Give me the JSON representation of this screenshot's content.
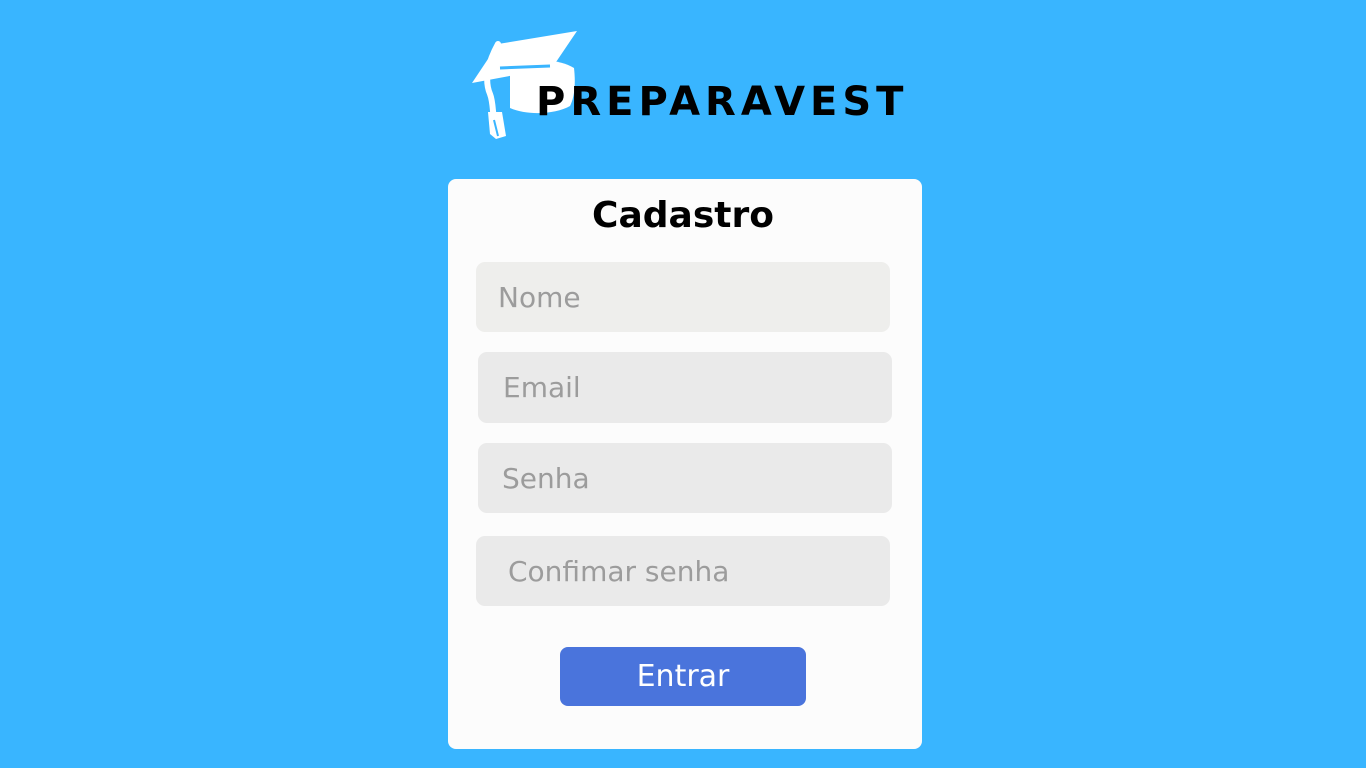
{
  "brand": {
    "name": "PREPARAVEST",
    "logo_icon": "graduation-cap-icon"
  },
  "form": {
    "title": "Cadastro",
    "fields": {
      "name_placeholder": "Nome",
      "email_placeholder": "Email",
      "password_placeholder": "Senha",
      "confirm_password_placeholder": "Confimar senha"
    },
    "submit_label": "Entrar"
  },
  "colors": {
    "background": "#39b5ff",
    "card": "#fcfcfc",
    "input": "#eaeaea",
    "button": "#4a74dc",
    "button_text": "#ffffff",
    "logo_icon": "#ffffff"
  }
}
